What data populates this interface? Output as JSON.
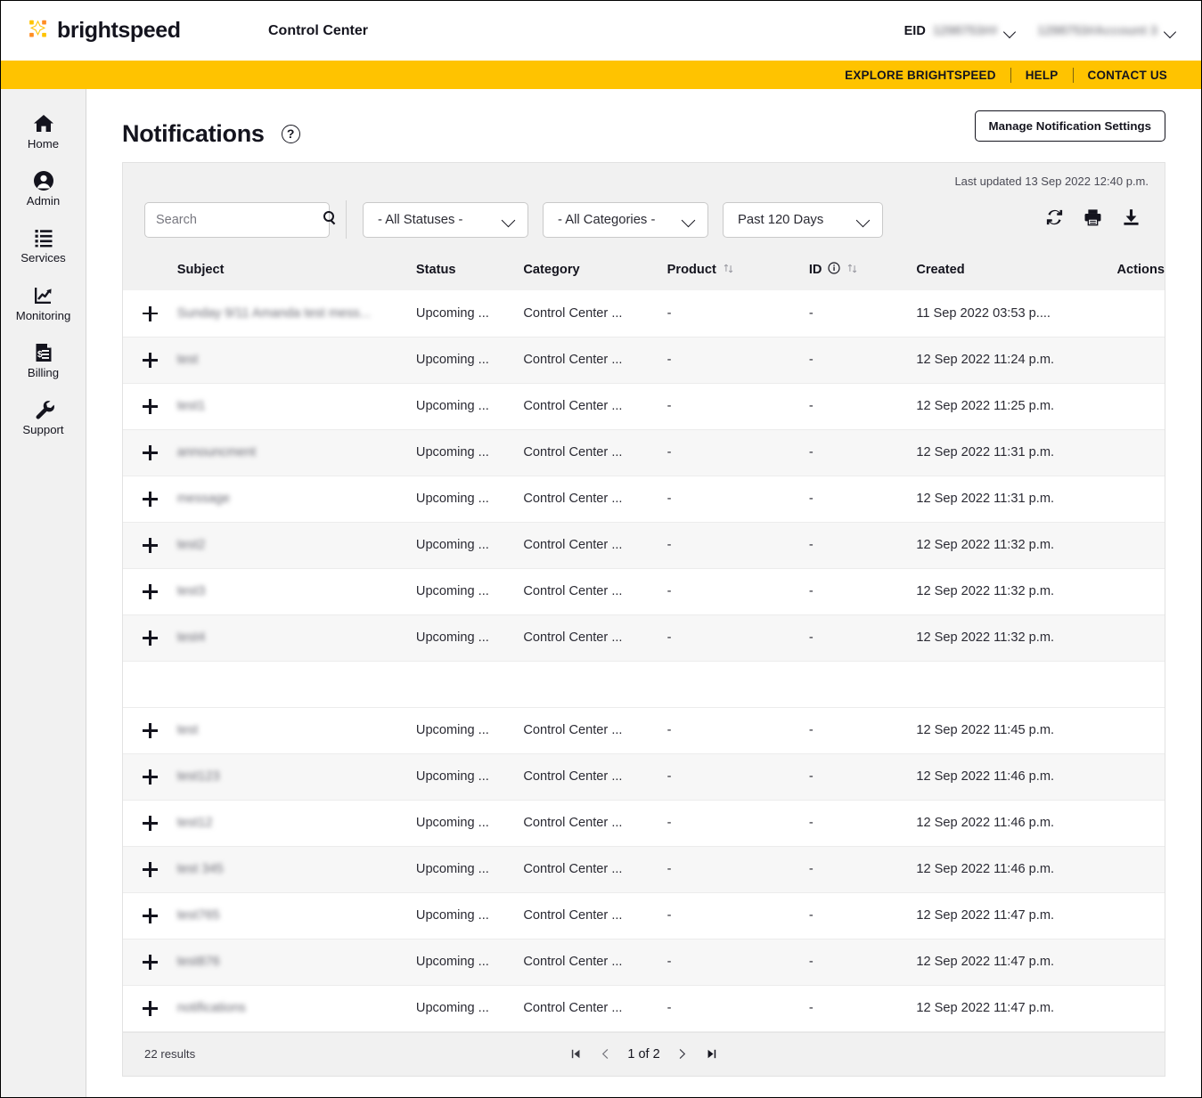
{
  "header": {
    "brand_name": "brightspeed",
    "app_title": "Control Center",
    "eid_label": "EID",
    "eid_value": "1298753##",
    "account_value": "1298753#Account 3"
  },
  "utility_bar": {
    "links": [
      {
        "label": "EXPLORE BRIGHTSPEED"
      },
      {
        "label": "HELP"
      },
      {
        "label": "CONTACT US"
      }
    ]
  },
  "sidebar": {
    "items": [
      {
        "label": "Home",
        "icon": "home-icon"
      },
      {
        "label": "Admin",
        "icon": "user-icon"
      },
      {
        "label": "Services",
        "icon": "list-icon"
      },
      {
        "label": "Monitoring",
        "icon": "chart-arrow-icon"
      },
      {
        "label": "Billing",
        "icon": "invoice-icon"
      },
      {
        "label": "Support",
        "icon": "wrench-icon"
      }
    ]
  },
  "page": {
    "title": "Notifications",
    "help_glyph": "?",
    "manage_button": "Manage Notification Settings"
  },
  "toolbar": {
    "last_updated": "Last updated 13 Sep 2022 12:40 p.m.",
    "search_placeholder": "Search",
    "search_value": "",
    "status_filter": "- All Statuses -",
    "category_filter": "- All Categories -",
    "date_filter": "Past 120 Days",
    "icons": [
      {
        "name": "refresh-icon"
      },
      {
        "name": "print-icon"
      },
      {
        "name": "download-icon"
      }
    ]
  },
  "table": {
    "columns": [
      {
        "key": "expand",
        "label": ""
      },
      {
        "key": "subject",
        "label": "Subject"
      },
      {
        "key": "status",
        "label": "Status"
      },
      {
        "key": "category",
        "label": "Category"
      },
      {
        "key": "product",
        "label": "Product",
        "sortable": true
      },
      {
        "key": "id",
        "label": "ID",
        "sortable": true,
        "info": true
      },
      {
        "key": "created",
        "label": "Created"
      },
      {
        "key": "actions",
        "label": "Actions"
      }
    ],
    "rows": [
      {
        "subject": "Sunday 9/11 Amanda test mess...",
        "status": "Upcoming ...",
        "category": "Control Center ...",
        "product": "-",
        "id": "-",
        "created": "11 Sep 2022 03:53 p...."
      },
      {
        "subject": "test",
        "status": "Upcoming ...",
        "category": "Control Center ...",
        "product": "-",
        "id": "-",
        "created": "12 Sep 2022 11:24 p.m."
      },
      {
        "subject": "test1",
        "status": "Upcoming ...",
        "category": "Control Center ...",
        "product": "-",
        "id": "-",
        "created": "12 Sep 2022 11:25 p.m."
      },
      {
        "subject": "announcment",
        "status": "Upcoming ...",
        "category": "Control Center ...",
        "product": "-",
        "id": "-",
        "created": "12 Sep 2022 11:31 p.m."
      },
      {
        "subject": "message",
        "status": "Upcoming ...",
        "category": "Control Center ...",
        "product": "-",
        "id": "-",
        "created": "12 Sep 2022 11:31 p.m."
      },
      {
        "subject": "test2",
        "status": "Upcoming ...",
        "category": "Control Center ...",
        "product": "-",
        "id": "-",
        "created": "12 Sep 2022 11:32 p.m."
      },
      {
        "subject": "test3",
        "status": "Upcoming ...",
        "category": "Control Center ...",
        "product": "-",
        "id": "-",
        "created": "12 Sep 2022 11:32 p.m."
      },
      {
        "subject": "test4",
        "status": "Upcoming ...",
        "category": "Control Center ...",
        "product": "-",
        "id": "-",
        "created": "12 Sep 2022 11:32 p.m."
      },
      {
        "subject": "test",
        "status": "Upcoming ...",
        "category": "Control Center ...",
        "product": "-",
        "id": "-",
        "created": "12 Sep 2022 11:45 p.m."
      },
      {
        "subject": "test123",
        "status": "Upcoming ...",
        "category": "Control Center ...",
        "product": "-",
        "id": "-",
        "created": "12 Sep 2022 11:46 p.m."
      },
      {
        "subject": "test12",
        "status": "Upcoming ...",
        "category": "Control Center ...",
        "product": "-",
        "id": "-",
        "created": "12 Sep 2022 11:46 p.m."
      },
      {
        "subject": "test 345",
        "status": "Upcoming ...",
        "category": "Control Center ...",
        "product": "-",
        "id": "-",
        "created": "12 Sep 2022 11:46 p.m."
      },
      {
        "subject": "test765",
        "status": "Upcoming ...",
        "category": "Control Center ...",
        "product": "-",
        "id": "-",
        "created": "12 Sep 2022 11:47 p.m."
      },
      {
        "subject": "test876",
        "status": "Upcoming ...",
        "category": "Control Center ...",
        "product": "-",
        "id": "-",
        "created": "12 Sep 2022 11:47 p.m."
      },
      {
        "subject": "notifications",
        "status": "Upcoming ...",
        "category": "Control Center ...",
        "product": "-",
        "id": "-",
        "created": "12 Sep 2022 11:47 p.m."
      }
    ]
  },
  "footer": {
    "results": "22 results",
    "page_current": "1",
    "page_of": "of",
    "page_total": "2"
  },
  "colors": {
    "brand_yellow": "#ffc300",
    "brand_orange": "#f5a000",
    "text": "#14141e",
    "panel_bg": "#f1f1f1",
    "row_alt": "#f7f7f7"
  }
}
